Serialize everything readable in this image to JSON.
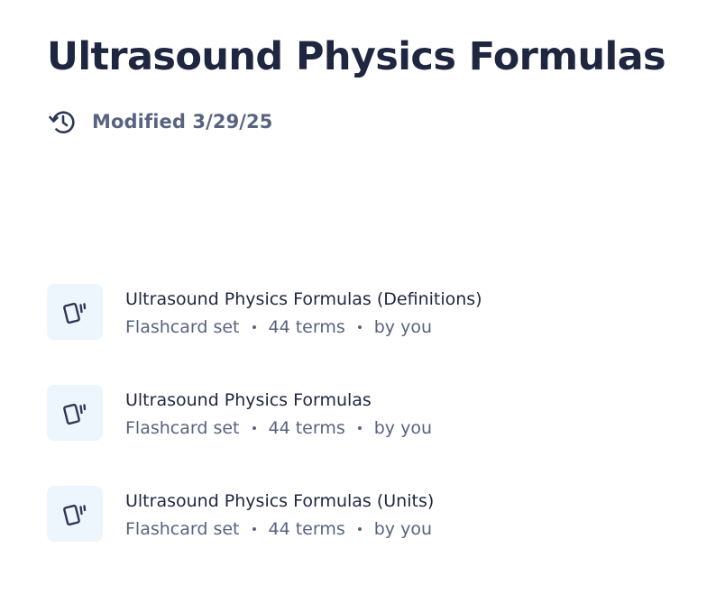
{
  "page": {
    "title": "Ultrasound Physics Formulas",
    "modified": "Modified 3/29/25"
  },
  "icons": {
    "history": "history-icon",
    "set": "flashcards-icon"
  },
  "colors": {
    "title": "#1f2640",
    "secondary": "#586380",
    "thumb_bg": "#edf6fd",
    "icon": "#2e3856"
  },
  "items": [
    {
      "title": "Ultrasound Physics Formulas (Definitions)",
      "type": "Flashcard set",
      "terms": "44 terms",
      "owner": "by you"
    },
    {
      "title": "Ultrasound Physics Formulas",
      "type": "Flashcard set",
      "terms": "44 terms",
      "owner": "by you"
    },
    {
      "title": "Ultrasound Physics Formulas (Units)",
      "type": "Flashcard set",
      "terms": "44 terms",
      "owner": "by you"
    }
  ]
}
